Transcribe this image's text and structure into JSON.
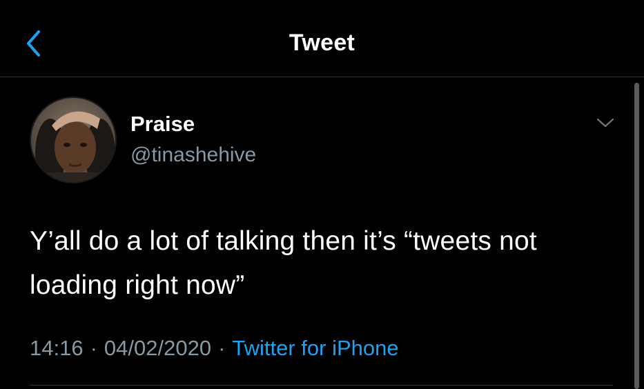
{
  "nav": {
    "title": "Tweet",
    "back_icon": "chevron-left-icon",
    "accent_color": "#1da1f2"
  },
  "tweet": {
    "author": {
      "display_name": "Praise",
      "username": "@tinashehive",
      "avatar_icon": "profile-photo"
    },
    "more_icon": "chevron-down-icon",
    "text": "Y’all do a lot of talking then it’s “tweets not loading right now”",
    "time": "14:16",
    "separator": "·",
    "date": "04/02/2020",
    "source": "Twitter for iPhone"
  },
  "colors": {
    "background": "#000000",
    "primary_text": "#ffffff",
    "secondary_text": "#8899a6",
    "link": "#1da1f2",
    "divider": "#2f3336"
  }
}
